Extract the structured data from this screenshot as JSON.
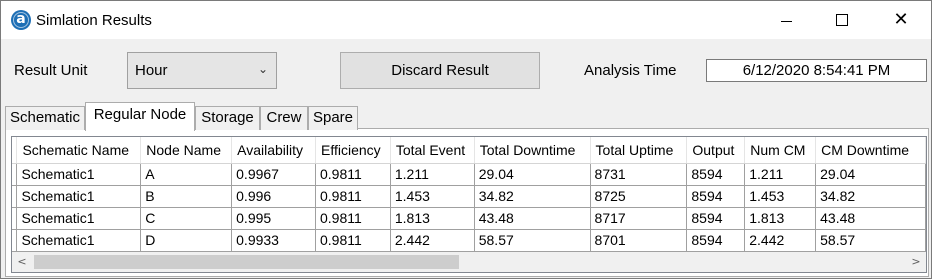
{
  "window": {
    "title": "Simlation Results",
    "icon_letter": "a"
  },
  "toolbar": {
    "result_unit_label": "Result Unit",
    "result_unit_value": "Hour",
    "discard_label": "Discard Result",
    "analysis_time_label": "Analysis Time",
    "analysis_time_value": "6/12/2020 8:54:41 PM"
  },
  "tabs": [
    {
      "label": "Schematic",
      "active": false
    },
    {
      "label": "Regular Node",
      "active": true
    },
    {
      "label": "Storage",
      "active": false
    },
    {
      "label": "Crew",
      "active": false
    },
    {
      "label": "Spare",
      "active": false
    }
  ],
  "grid": {
    "columns": [
      "Schematic Name",
      "Node Name",
      "Availability",
      "Efficiency",
      "Total Event",
      "Total Downtime",
      "Total Uptime",
      "Output",
      "Num CM",
      "CM Downtime"
    ],
    "rows": [
      [
        "Schematic1",
        "A",
        "0.9967",
        "0.9811",
        "1.211",
        "29.04",
        "8731",
        "8594",
        "1.211",
        "29.04"
      ],
      [
        "Schematic1",
        "B",
        "0.996",
        "0.9811",
        "1.453",
        "34.82",
        "8725",
        "8594",
        "1.453",
        "34.82"
      ],
      [
        "Schematic1",
        "C",
        "0.995",
        "0.9811",
        "1.813",
        "43.48",
        "8717",
        "8594",
        "1.813",
        "43.48"
      ],
      [
        "Schematic1",
        "D",
        "0.9933",
        "0.9811",
        "2.442",
        "58.57",
        "8701",
        "8594",
        "2.442",
        "58.57"
      ]
    ]
  },
  "icons": {
    "app": "app-logo-icon",
    "minimize": "minimize-icon",
    "maximize": "maximize-icon",
    "close": "close-icon",
    "dropdown": "chevron-down-icon",
    "scroll_left": "chevron-left-icon",
    "scroll_right": "chevron-right-icon"
  }
}
